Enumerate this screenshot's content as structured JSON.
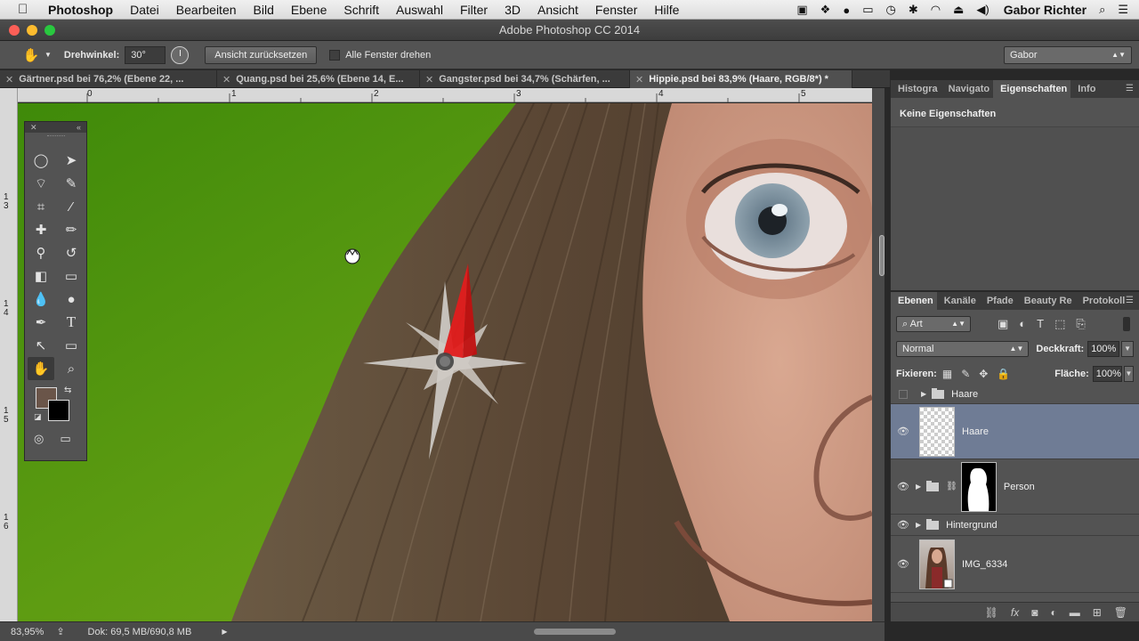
{
  "menubar": {
    "apple": "",
    "app_name": "Photoshop",
    "items": [
      "Datei",
      "Bearbeiten",
      "Bild",
      "Ebene",
      "Schrift",
      "Auswahl",
      "Filter",
      "3D",
      "Ansicht",
      "Fenster",
      "Hilfe"
    ],
    "user": "Gabor Richter"
  },
  "window": {
    "title": "Adobe Photoshop CC 2014"
  },
  "options": {
    "angle_label": "Drehwinkel:",
    "angle_value": "30°",
    "reset_button": "Ansicht zurücksetzen",
    "rotate_all_label": "Alle Fenster drehen",
    "workspace": "Gabor"
  },
  "tabs": [
    {
      "label": "Gärtner.psd bei 76,2% (Ebene 22, ..."
    },
    {
      "label": "Quang.psd bei 25,6% (Ebene 14, E..."
    },
    {
      "label": "Gangster.psd bei 34,7% (Schärfen, ..."
    },
    {
      "label": "Hippie.psd bei 83,9% (Haare, RGB/8*) *"
    }
  ],
  "ruler": {
    "top": [
      "0",
      "1",
      "2",
      "3",
      "4",
      "5"
    ],
    "left": [
      "1\n3",
      "1\n4",
      "1\n5",
      "1\n6"
    ]
  },
  "status": {
    "zoom": "83,95%",
    "doc": "Dok: 69,5 MB/690,8 MB"
  },
  "props_panel": {
    "tabs": [
      "Histogra",
      "Navigato",
      "Eigenschaften",
      "Info"
    ],
    "active_tab": "Eigenschaften",
    "empty_text": "Keine Eigenschaften"
  },
  "layers_panel": {
    "tabs": [
      "Ebenen",
      "Kanäle",
      "Pfade",
      "Beauty Re",
      "Protokoll"
    ],
    "filter": "Art",
    "blend_mode": "Normal",
    "opacity_label": "Deckkraft:",
    "opacity": "100%",
    "lock_label": "Fixieren:",
    "fill_label": "Fläche:",
    "fill": "100%",
    "layers": [
      {
        "name": "Haare",
        "kind": "group",
        "visible": false
      },
      {
        "name": "Haare",
        "kind": "layer",
        "visible": true,
        "selected": true
      },
      {
        "name": "Person",
        "kind": "group-mask",
        "visible": true
      },
      {
        "name": "Hintergrund",
        "kind": "group",
        "visible": true
      },
      {
        "name": "IMG_6334",
        "kind": "smart",
        "visible": true
      }
    ]
  },
  "colors": {
    "foreground": "#6a5549",
    "background": "#000000",
    "selection": "#6f7c95"
  }
}
